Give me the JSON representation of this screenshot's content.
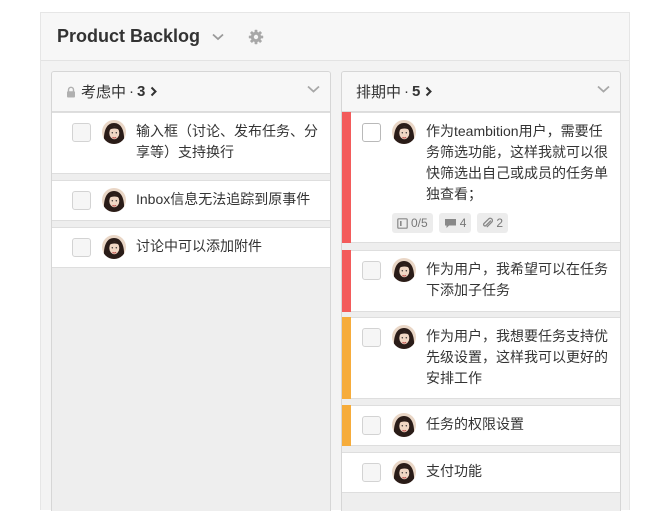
{
  "board": {
    "title": "Product Backlog"
  },
  "stages": [
    {
      "title": "考虑中",
      "separator": "·",
      "count": "3",
      "locked": true,
      "cards": [
        {
          "text": "输入框（讨论、发布任务、分享等）支持换行"
        },
        {
          "text": "Inbox信息无法追踪到原事件"
        },
        {
          "text": "讨论中可以添加附件"
        }
      ]
    },
    {
      "title": "排期中",
      "separator": "·",
      "count": "5",
      "locked": false,
      "cards": [
        {
          "text": "作为teambition用户，需要任务筛选功能，这样我就可以很快筛选出自己或成员的任务单独查看；",
          "priority": "red",
          "badges": {
            "subtasks": "0/5",
            "comments": "4",
            "attachments": "2"
          }
        },
        {
          "text": "作为用户，我希望可以在任务下添加子任务",
          "priority": "red"
        },
        {
          "text": "作为用户，我想要任务支持优先级设置，这样我可以更好的安排工作",
          "priority": "orange"
        },
        {
          "text": "任务的权限设置",
          "priority": "orange"
        },
        {
          "text": "支付功能"
        }
      ]
    }
  ],
  "colors": {
    "priority_red": "#f35b5b",
    "priority_orange": "#f6ac3b"
  },
  "icons": [
    "chevron-down-icon",
    "gear-icon",
    "lock-icon",
    "chevron-right-icon",
    "avatar",
    "checklist-icon",
    "comment-icon",
    "paperclip-icon"
  ]
}
